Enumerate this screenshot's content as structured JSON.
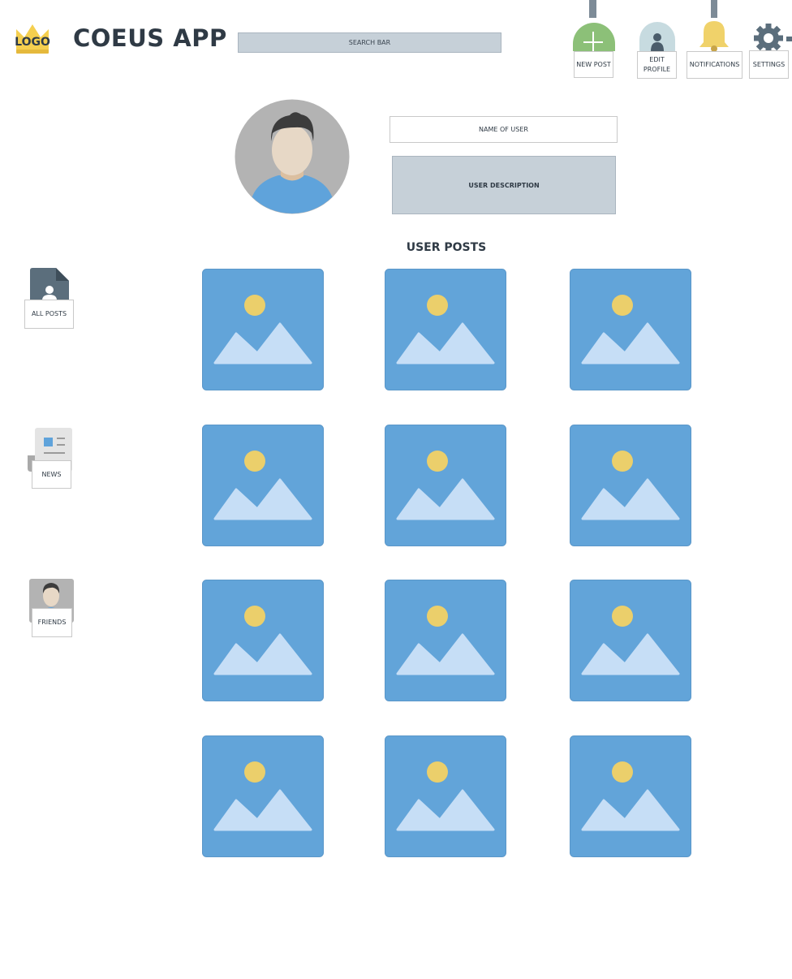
{
  "header": {
    "logo_text": "LOGO",
    "app_title": "COEUS APP",
    "search_label": "SEARCH BAR",
    "actions": {
      "new_post": "NEW POST",
      "edit_profile": "EDIT PROFILE",
      "notifications": "NOTIFICATIONS",
      "settings": "SETTINGS"
    }
  },
  "profile": {
    "name_label": "NAME OF USER",
    "description_label": "USER DESCRIPTION"
  },
  "posts": {
    "title": "USER POSTS",
    "count": 12
  },
  "sidebar": {
    "all_posts": "ALL POSTS",
    "news": "NEWS",
    "friends": "FRIENDS"
  },
  "colors": {
    "image_tile": "#62a4d9",
    "sun": "#ebcf6b",
    "mountain": "#c6def6",
    "dark_slate": "#5b6e7c",
    "green": "#8cc078",
    "bell": "#f0d26a",
    "title_text": "#2f3a45"
  }
}
